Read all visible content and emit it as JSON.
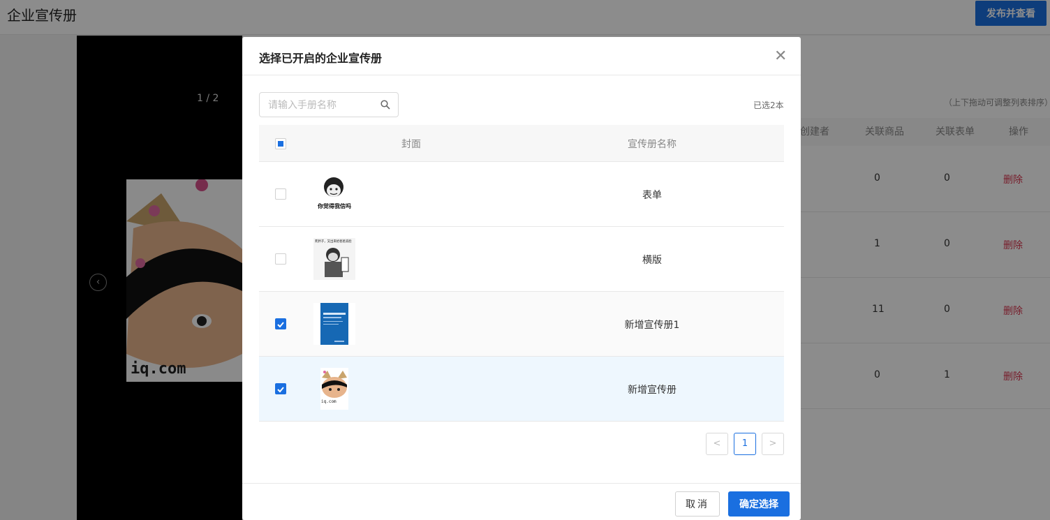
{
  "page": {
    "title": "企业宣传册",
    "publish_button": "发布并查看"
  },
  "preview": {
    "page_indicator": "1 / 2",
    "watermark": "iq.com"
  },
  "bg_table": {
    "hint": "（上下拖动可调整列表排序）",
    "headers": [
      "创建者",
      "关联商品",
      "关联表单",
      "操作"
    ],
    "rows": [
      {
        "products": "0",
        "forms": "0",
        "action": "删除"
      },
      {
        "products": "1",
        "forms": "0",
        "action": "删除"
      },
      {
        "products": "11",
        "forms": "0",
        "action": "删除"
      },
      {
        "products": "0",
        "forms": "1",
        "action": "删除"
      }
    ]
  },
  "modal": {
    "title": "选择已开启的企业宣传册",
    "search_placeholder": "请输入手册名称",
    "selected_count": "已选2本",
    "columns": {
      "cover": "封面",
      "name": "宣传册名称"
    },
    "rows": [
      {
        "name": "表单",
        "checked": false,
        "cover_caption": "你觉得我信吗"
      },
      {
        "name": "横版",
        "checked": false,
        "cover_caption": "死胖子，又出来给爸爸丢脸"
      },
      {
        "name": "新增宣传册1",
        "checked": true,
        "cover_caption": ""
      },
      {
        "name": "新增宣传册",
        "checked": true,
        "cover_caption": "iq.com"
      }
    ],
    "pagination": {
      "prev": "<",
      "current": "1",
      "next": ">"
    },
    "cancel_label": "取消",
    "confirm_label": "确定选择"
  },
  "colors": {
    "primary": "#1a6fe0",
    "danger": "#d9364f"
  }
}
